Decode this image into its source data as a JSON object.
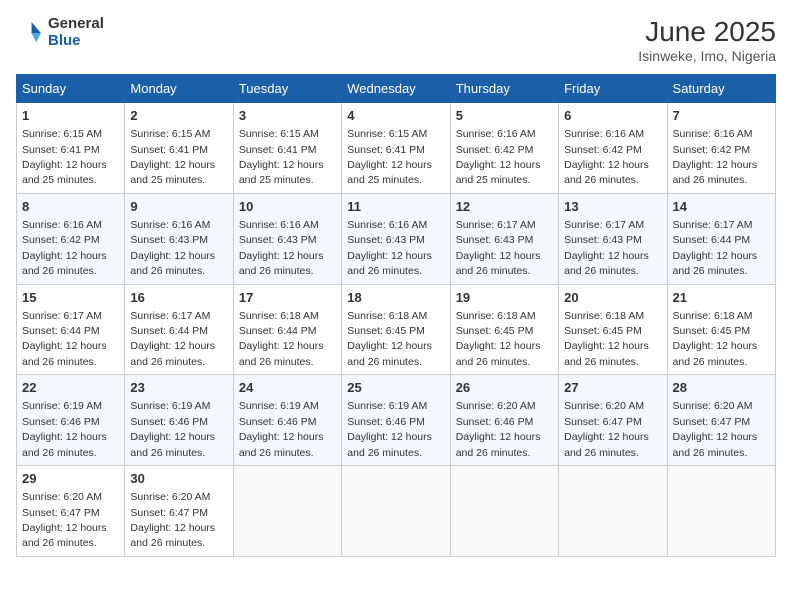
{
  "logo": {
    "general": "General",
    "blue": "Blue"
  },
  "title": "June 2025",
  "subtitle": "Isinweke, Imo, Nigeria",
  "headers": [
    "Sunday",
    "Monday",
    "Tuesday",
    "Wednesday",
    "Thursday",
    "Friday",
    "Saturday"
  ],
  "weeks": [
    [
      {
        "day": "1",
        "sunrise": "6:15 AM",
        "sunset": "6:41 PM",
        "daylight": "12 hours and 25 minutes."
      },
      {
        "day": "2",
        "sunrise": "6:15 AM",
        "sunset": "6:41 PM",
        "daylight": "12 hours and 25 minutes."
      },
      {
        "day": "3",
        "sunrise": "6:15 AM",
        "sunset": "6:41 PM",
        "daylight": "12 hours and 25 minutes."
      },
      {
        "day": "4",
        "sunrise": "6:15 AM",
        "sunset": "6:41 PM",
        "daylight": "12 hours and 25 minutes."
      },
      {
        "day": "5",
        "sunrise": "6:16 AM",
        "sunset": "6:42 PM",
        "daylight": "12 hours and 25 minutes."
      },
      {
        "day": "6",
        "sunrise": "6:16 AM",
        "sunset": "6:42 PM",
        "daylight": "12 hours and 26 minutes."
      },
      {
        "day": "7",
        "sunrise": "6:16 AM",
        "sunset": "6:42 PM",
        "daylight": "12 hours and 26 minutes."
      }
    ],
    [
      {
        "day": "8",
        "sunrise": "6:16 AM",
        "sunset": "6:42 PM",
        "daylight": "12 hours and 26 minutes."
      },
      {
        "day": "9",
        "sunrise": "6:16 AM",
        "sunset": "6:43 PM",
        "daylight": "12 hours and 26 minutes."
      },
      {
        "day": "10",
        "sunrise": "6:16 AM",
        "sunset": "6:43 PM",
        "daylight": "12 hours and 26 minutes."
      },
      {
        "day": "11",
        "sunrise": "6:16 AM",
        "sunset": "6:43 PM",
        "daylight": "12 hours and 26 minutes."
      },
      {
        "day": "12",
        "sunrise": "6:17 AM",
        "sunset": "6:43 PM",
        "daylight": "12 hours and 26 minutes."
      },
      {
        "day": "13",
        "sunrise": "6:17 AM",
        "sunset": "6:43 PM",
        "daylight": "12 hours and 26 minutes."
      },
      {
        "day": "14",
        "sunrise": "6:17 AM",
        "sunset": "6:44 PM",
        "daylight": "12 hours and 26 minutes."
      }
    ],
    [
      {
        "day": "15",
        "sunrise": "6:17 AM",
        "sunset": "6:44 PM",
        "daylight": "12 hours and 26 minutes."
      },
      {
        "day": "16",
        "sunrise": "6:17 AM",
        "sunset": "6:44 PM",
        "daylight": "12 hours and 26 minutes."
      },
      {
        "day": "17",
        "sunrise": "6:18 AM",
        "sunset": "6:44 PM",
        "daylight": "12 hours and 26 minutes."
      },
      {
        "day": "18",
        "sunrise": "6:18 AM",
        "sunset": "6:45 PM",
        "daylight": "12 hours and 26 minutes."
      },
      {
        "day": "19",
        "sunrise": "6:18 AM",
        "sunset": "6:45 PM",
        "daylight": "12 hours and 26 minutes."
      },
      {
        "day": "20",
        "sunrise": "6:18 AM",
        "sunset": "6:45 PM",
        "daylight": "12 hours and 26 minutes."
      },
      {
        "day": "21",
        "sunrise": "6:18 AM",
        "sunset": "6:45 PM",
        "daylight": "12 hours and 26 minutes."
      }
    ],
    [
      {
        "day": "22",
        "sunrise": "6:19 AM",
        "sunset": "6:46 PM",
        "daylight": "12 hours and 26 minutes."
      },
      {
        "day": "23",
        "sunrise": "6:19 AM",
        "sunset": "6:46 PM",
        "daylight": "12 hours and 26 minutes."
      },
      {
        "day": "24",
        "sunrise": "6:19 AM",
        "sunset": "6:46 PM",
        "daylight": "12 hours and 26 minutes."
      },
      {
        "day": "25",
        "sunrise": "6:19 AM",
        "sunset": "6:46 PM",
        "daylight": "12 hours and 26 minutes."
      },
      {
        "day": "26",
        "sunrise": "6:20 AM",
        "sunset": "6:46 PM",
        "daylight": "12 hours and 26 minutes."
      },
      {
        "day": "27",
        "sunrise": "6:20 AM",
        "sunset": "6:47 PM",
        "daylight": "12 hours and 26 minutes."
      },
      {
        "day": "28",
        "sunrise": "6:20 AM",
        "sunset": "6:47 PM",
        "daylight": "12 hours and 26 minutes."
      }
    ],
    [
      {
        "day": "29",
        "sunrise": "6:20 AM",
        "sunset": "6:47 PM",
        "daylight": "12 hours and 26 minutes."
      },
      {
        "day": "30",
        "sunrise": "6:20 AM",
        "sunset": "6:47 PM",
        "daylight": "12 hours and 26 minutes."
      },
      null,
      null,
      null,
      null,
      null
    ]
  ]
}
